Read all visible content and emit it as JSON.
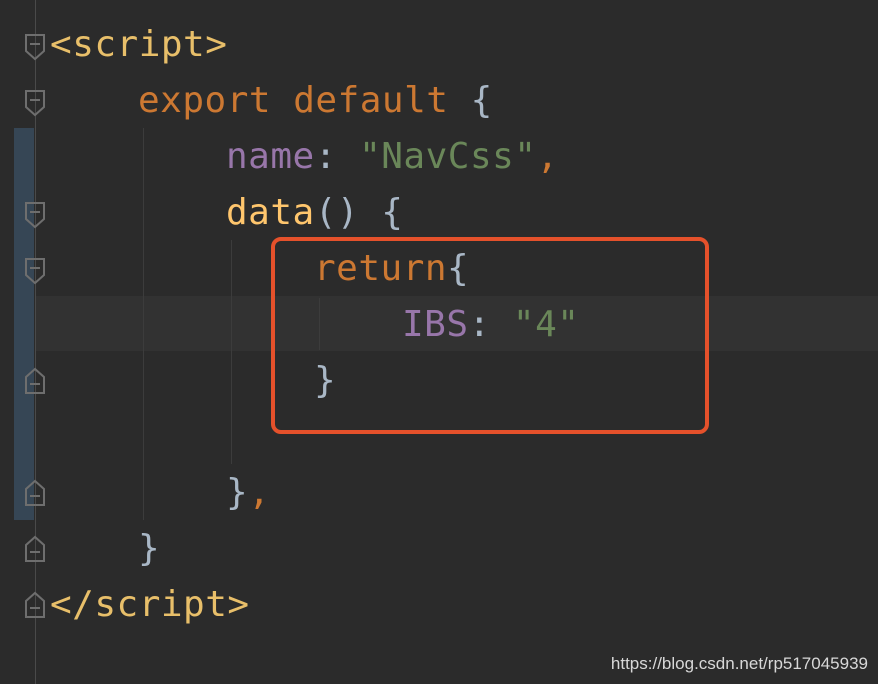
{
  "code": {
    "line1": {
      "open": "<",
      "tag": "script",
      "close": ">"
    },
    "line2": {
      "kw_export": "export",
      "kw_default": "default",
      "brace": "{"
    },
    "line3": {
      "prop": "name",
      "colon": ":",
      "value": "\"NavCss\"",
      "comma": ","
    },
    "line4": {
      "fn": "data",
      "parens": "()",
      "brace": "{"
    },
    "line5": {
      "kw": "return",
      "brace": "{"
    },
    "line6": {
      "prop": "IBS",
      "colon": ":",
      "value": "\"4\""
    },
    "line7": {
      "brace": "}"
    },
    "line8": {
      "brace": "}",
      "comma": ","
    },
    "line9": {
      "brace": "}"
    },
    "line10": {
      "open": "</",
      "tag": "script",
      "close": ">"
    }
  },
  "watermark": "https://blog.csdn.net/rp517045939",
  "colors": {
    "background": "#2b2b2b",
    "tag": "#e8bf6a",
    "keyword": "#cc7832",
    "property": "#9876aa",
    "string": "#6a8759",
    "function": "#ffc66d",
    "punctuation": "#a9b7c6",
    "annotation_box": "#e5512b"
  }
}
